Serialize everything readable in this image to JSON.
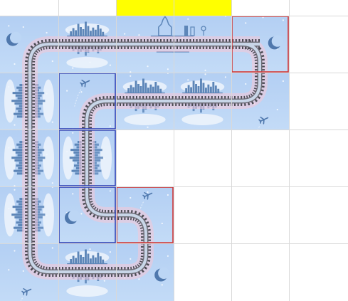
{
  "grid": {
    "cols": 6,
    "rows": 5,
    "header_rows": 1
  },
  "colors": {
    "background": "#ffffff",
    "grid_line": "#d9d9d9",
    "tile": "#b7d3f5",
    "tile_dark": "#6d93c7",
    "city": "#5d86b8",
    "cloud": "#eef4fc",
    "track_tie": "#4a4a52",
    "track_rail": "#6e6e78",
    "track_glow": "#f6c6d6",
    "header_highlight": "#ffff00",
    "frame_red": "#d03a3a",
    "frame_blue": "#3547b8"
  },
  "header_highlights": [
    {
      "col": 2
    },
    {
      "col": 3
    }
  ],
  "tiles": [
    {
      "row": 0,
      "col": 0,
      "kind": "corner",
      "art": [
        "moon",
        "stars"
      ]
    },
    {
      "row": 0,
      "col": 1,
      "kind": "horizontal",
      "art": [
        "city-skyline-reflected"
      ]
    },
    {
      "row": 0,
      "col": 2,
      "kind": "horizontal",
      "art": [
        "tower-castle"
      ]
    },
    {
      "row": 0,
      "col": 3,
      "kind": "horizontal",
      "art": [
        "sign-post"
      ]
    },
    {
      "row": 0,
      "col": 4,
      "kind": "corner",
      "art": [
        "moon",
        "stars"
      ]
    },
    {
      "row": 1,
      "col": 0,
      "kind": "vertical",
      "art": [
        "city-skyline-vertical"
      ]
    },
    {
      "row": 1,
      "col": 1,
      "kind": "corner",
      "art": [
        "airplane"
      ]
    },
    {
      "row": 1,
      "col": 2,
      "kind": "horizontal",
      "art": [
        "city-skyline-reflected"
      ]
    },
    {
      "row": 1,
      "col": 3,
      "kind": "horizontal",
      "art": [
        "city-skyline-reflected"
      ]
    },
    {
      "row": 1,
      "col": 4,
      "kind": "corner",
      "art": [
        "airplane"
      ]
    },
    {
      "row": 2,
      "col": 0,
      "kind": "vertical",
      "art": [
        "city-skyline-vertical"
      ]
    },
    {
      "row": 2,
      "col": 1,
      "kind": "vertical",
      "art": [
        "city-skyline-vertical"
      ]
    },
    {
      "row": 3,
      "col": 0,
      "kind": "vertical",
      "art": [
        "city-skyline-vertical"
      ]
    },
    {
      "row": 3,
      "col": 1,
      "kind": "corner",
      "art": [
        "moon",
        "stars"
      ]
    },
    {
      "row": 3,
      "col": 2,
      "kind": "corner",
      "art": [
        "airplane"
      ]
    },
    {
      "row": 4,
      "col": 0,
      "kind": "corner",
      "art": [
        "airplane"
      ]
    },
    {
      "row": 4,
      "col": 1,
      "kind": "horizontal",
      "art": [
        "city-skyline-reflected"
      ]
    },
    {
      "row": 4,
      "col": 2,
      "kind": "corner",
      "art": [
        "moon",
        "stars"
      ]
    }
  ],
  "frames": [
    {
      "row": 0,
      "col": 4,
      "color": "red"
    },
    {
      "row": 3,
      "col": 2,
      "color": "red"
    },
    {
      "row": 1,
      "col": 1,
      "color": "blue"
    },
    {
      "row": 2,
      "col": 1,
      "color": "blue"
    },
    {
      "row": 3,
      "col": 1,
      "color": "blue"
    }
  ]
}
